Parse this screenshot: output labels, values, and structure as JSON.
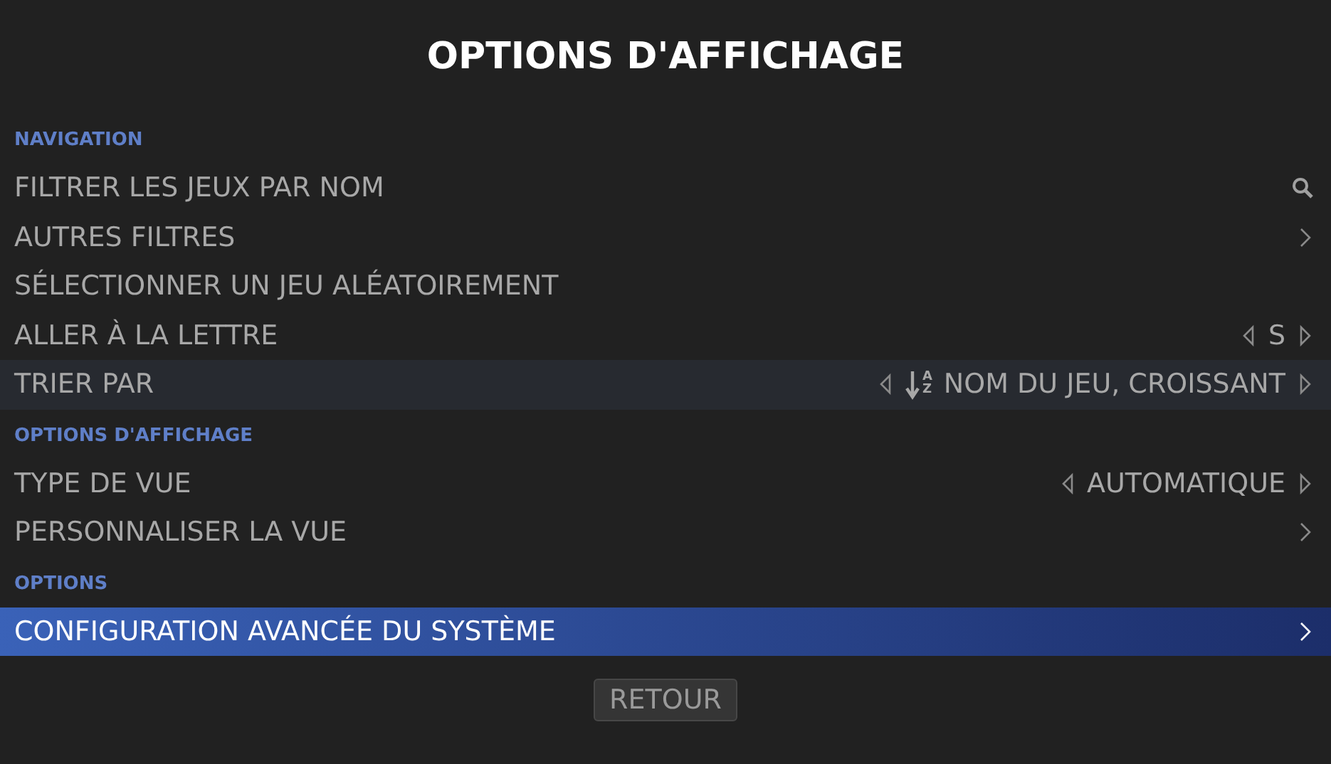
{
  "title": "OPTIONS D'AFFICHAGE",
  "sections": [
    {
      "header": "NAVIGATION",
      "items": [
        {
          "label": "FILTRER LES JEUX PAR NOM",
          "kind": "search",
          "selected": false,
          "hovered": false
        },
        {
          "label": "AUTRES FILTRES",
          "kind": "submenu",
          "selected": false,
          "hovered": false
        },
        {
          "label": "SÉLECTIONNER UN JEU ALÉATOIREMENT",
          "kind": "plain",
          "selected": false,
          "hovered": false
        },
        {
          "label": "ALLER À LA LETTRE",
          "kind": "cycle",
          "value": "S",
          "selected": false,
          "hovered": false
        },
        {
          "label": "TRIER PAR",
          "kind": "sort",
          "value": "NOM DU JEU, CROISSANT",
          "sort_letters": [
            "A",
            "Z"
          ],
          "selected": false,
          "hovered": true
        }
      ]
    },
    {
      "header": "OPTIONS D'AFFICHAGE",
      "items": [
        {
          "label": "TYPE DE VUE",
          "kind": "cycle",
          "value": "AUTOMATIQUE",
          "selected": false,
          "hovered": false
        },
        {
          "label": "PERSONNALISER LA VUE",
          "kind": "submenu",
          "selected": false,
          "hovered": false
        }
      ]
    },
    {
      "header": "OPTIONS",
      "items": [
        {
          "label": "CONFIGURATION AVANCÉE DU SYSTÈME",
          "kind": "submenu",
          "selected": true,
          "hovered": false
        }
      ]
    }
  ],
  "back_button": "RETOUR"
}
